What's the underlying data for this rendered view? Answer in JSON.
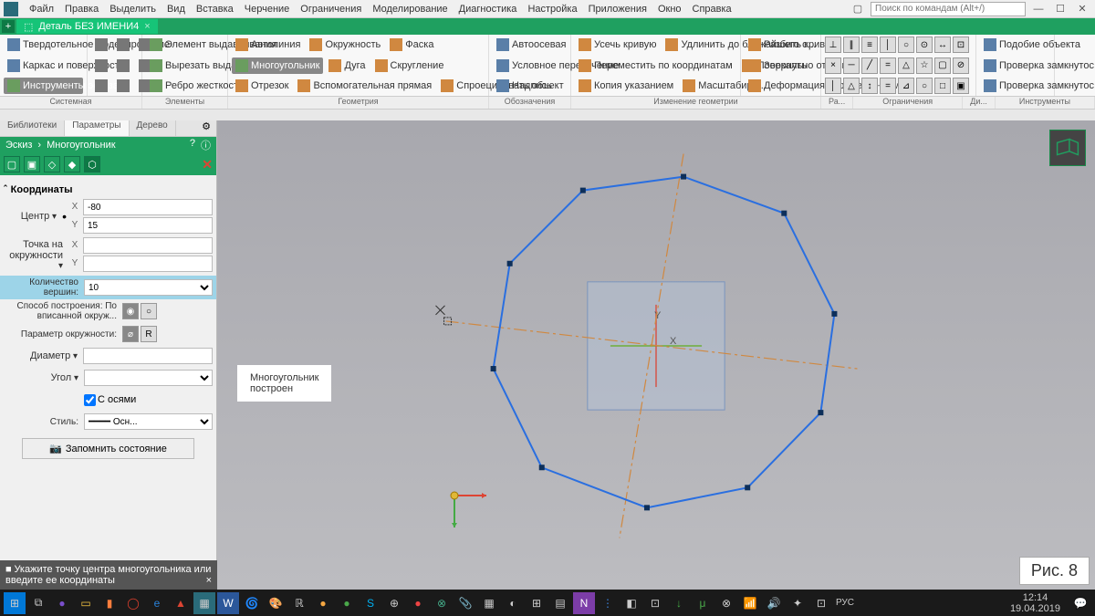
{
  "menu": {
    "items": [
      "Файл",
      "Правка",
      "Выделить",
      "Вид",
      "Вставка",
      "Черчение",
      "Ограничения",
      "Моделирование",
      "Диагностика",
      "Настройка",
      "Приложения",
      "Окно",
      "Справка"
    ],
    "search_ph": "Поиск по командам (Alt+/)"
  },
  "doc_tab": "Деталь БЕЗ ИМЕНИ4",
  "ribbon": {
    "c1": [
      [
        "Твердотельное моделирование"
      ],
      [
        "Каркас и поверхности"
      ],
      [
        "Инструменты эскиза"
      ]
    ],
    "c2": [
      [
        "Элемент выдавливания"
      ],
      [
        "Вырезать выдавливанием"
      ],
      [
        "Ребро жесткости"
      ]
    ],
    "c3": [
      [
        "Автолиния",
        "Окружность",
        "Фаска"
      ],
      [
        "Многоугольник",
        "Дуга",
        "Скругление"
      ],
      [
        "Отрезок",
        "Вспомогательная прямая",
        "Спроецировать объект"
      ]
    ],
    "c4": [
      [
        "Автоосевая"
      ],
      [
        "Условное пересечение"
      ],
      [
        "Надпись"
      ]
    ],
    "c5": [
      [
        "Усечь кривую",
        "Удлинить до ближайшего о..."
      ],
      [
        "Переместить по координатам",
        "Повернуть"
      ],
      [
        "Копия указанием",
        "Масштабиро..."
      ]
    ],
    "c6": [
      [
        "Разбить кривую"
      ],
      [
        "Зеркально отразить"
      ],
      [
        "Деформация перемещением"
      ]
    ],
    "c7": [
      [
        "Подобие объекта"
      ],
      [
        "Проверка замкнутос..."
      ],
      [
        "Проверка замкнутос..."
      ]
    ],
    "groups": [
      "Системная",
      "Элементы",
      "Геометрия",
      "Обозначения",
      "Изменение геометрии",
      "Ра...",
      "Ограничения",
      "Ди...",
      "Инструменты"
    ]
  },
  "left": {
    "tabs": [
      "Библиотеки",
      "Параметры",
      "Дерево"
    ],
    "bc": [
      "Эскиз",
      "Многоугольник"
    ],
    "sec": "Координаты",
    "center_lbl": "Центр",
    "center_x": "-80",
    "center_y": "15",
    "point_lbl": "Точка на окружности",
    "verts_lbl": "Количество вершин:",
    "verts": "10",
    "method_lbl": "Способ построения: По вписанной окруж...",
    "circparam_lbl": "Параметр окружности:",
    "diam_lbl": "Диаметр",
    "angle_lbl": "Угол",
    "axes_lbl": "С осями",
    "style_lbl": "Стиль:",
    "style_val": "Осн...",
    "memory": "Запомнить состояние"
  },
  "hint": "Укажите точку центра многоугольника или введите ее координаты",
  "note1": "Многоугольник",
  "note2": "построен",
  "fig": "Рис. 8",
  "clock": {
    "t": "12:14",
    "d": "19.04.2019"
  },
  "lang": "РУС"
}
